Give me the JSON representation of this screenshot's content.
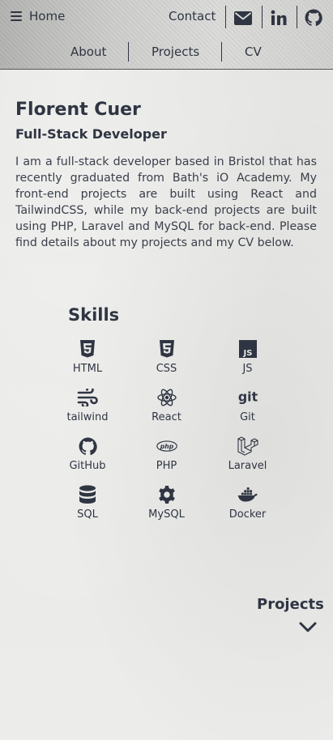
{
  "header": {
    "home_label": "Home",
    "contact_label": "Contact",
    "nav": {
      "about": "About",
      "projects": "Projects",
      "cv": "CV"
    }
  },
  "intro": {
    "name": "Florent Cuer",
    "role": "Full-Stack Developer",
    "bio": "I am a full-stack developer based in Bristol that has recently graduated from Bath's iO Academy. My front-end projects are built using React and TailwindCSS, while my back-end projects are built using PHP, Laravel and MySQL for back-end. Please find details about my projects and my CV below."
  },
  "skills": {
    "title": "Skills",
    "items": [
      {
        "label": "HTML",
        "icon": "html5-icon"
      },
      {
        "label": "CSS",
        "icon": "css3-icon"
      },
      {
        "label": "JS",
        "icon": "js-icon"
      },
      {
        "label": "tailwind",
        "icon": "tailwind-icon"
      },
      {
        "label": "React",
        "icon": "react-icon"
      },
      {
        "label": "Git",
        "icon": "git-icon"
      },
      {
        "label": "GitHub",
        "icon": "github-icon"
      },
      {
        "label": "PHP",
        "icon": "php-icon"
      },
      {
        "label": "Laravel",
        "icon": "laravel-icon"
      },
      {
        "label": "SQL",
        "icon": "database-icon"
      },
      {
        "label": "MySQL",
        "icon": "gear-icon"
      },
      {
        "label": "Docker",
        "icon": "docker-icon"
      }
    ]
  },
  "projects_section": {
    "label": "Projects"
  },
  "colors": {
    "text": "#2f3542",
    "background": "#e6e6e4"
  }
}
